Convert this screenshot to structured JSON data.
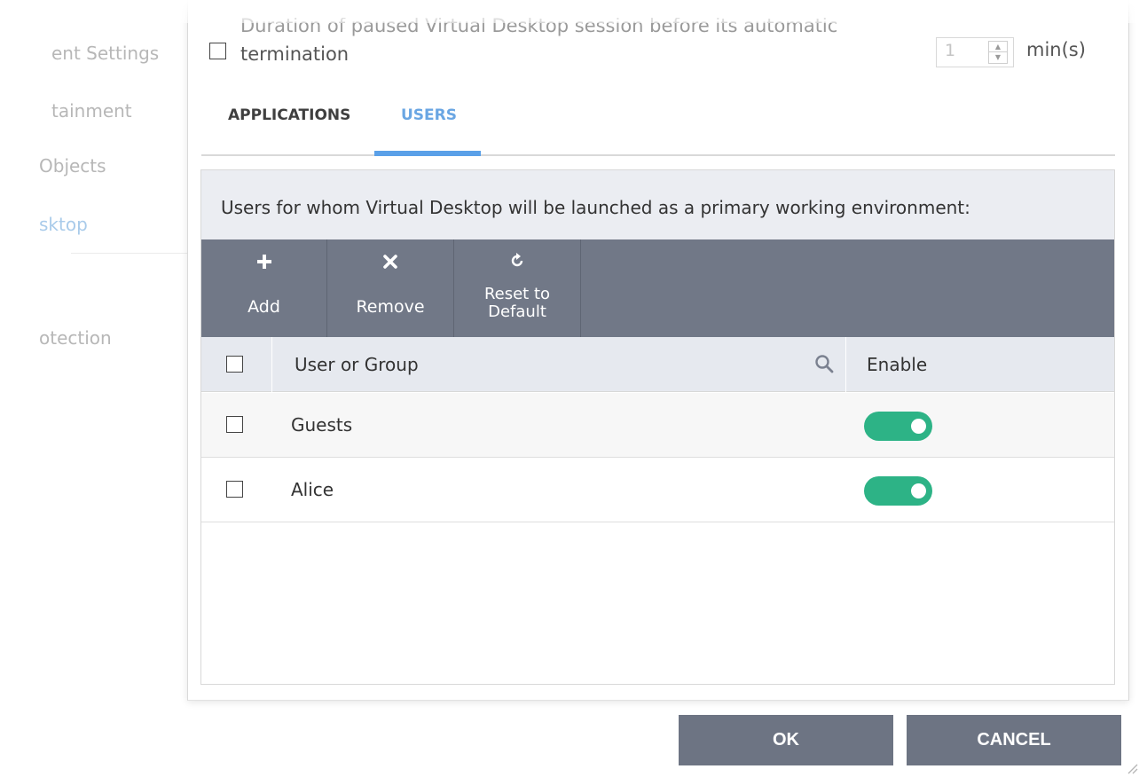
{
  "sidebar": {
    "items": [
      {
        "label": "ent Settings"
      },
      {
        "label": "tainment"
      },
      {
        "label": " Objects"
      },
      {
        "label": "sktop"
      },
      {
        "label": "otection"
      }
    ]
  },
  "duration": {
    "label_line1": "Duration of paused Virtual Desktop session before its automatic",
    "label_line2": "termination",
    "value": "1",
    "unit": "min(s)"
  },
  "tabs": [
    {
      "label": "APPLICATIONS"
    },
    {
      "label": "USERS"
    }
  ],
  "panel": {
    "description": "Users for whom Virtual Desktop will be launched as a primary working environment:"
  },
  "toolbar": {
    "add_label": "Add",
    "remove_label": "Remove",
    "reset_label_line1": "Reset to",
    "reset_label_line2": "Default"
  },
  "table": {
    "columns": {
      "user": "User or Group",
      "enable": "Enable"
    },
    "rows": [
      {
        "name": "Guests",
        "enabled": true
      },
      {
        "name": "Alice",
        "enabled": true
      }
    ]
  },
  "footer": {
    "ok_label": "OK",
    "cancel_label": "CANCEL"
  },
  "colors": {
    "accent": "#5aa0e8",
    "toolbar": "#717887",
    "toggle_on": "#2db386",
    "button": "#6d7483"
  },
  "icons": {
    "add": "plus-icon",
    "remove": "x-icon",
    "reset": "refresh-icon",
    "search": "search-icon"
  }
}
